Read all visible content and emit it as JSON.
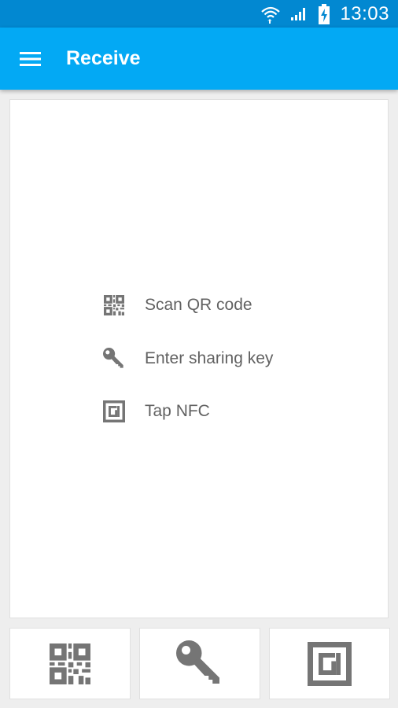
{
  "status_bar": {
    "time": "13:03",
    "icons": [
      "wifi-icon",
      "signal-icon",
      "battery-charging-icon"
    ]
  },
  "app_bar": {
    "title": "Receive",
    "menu_icon": "menu-icon"
  },
  "options": [
    {
      "label": "Scan QR code",
      "icon": "qr-code-icon"
    },
    {
      "label": "Enter sharing key",
      "icon": "key-icon"
    },
    {
      "label": "Tap NFC",
      "icon": "nfc-icon"
    }
  ],
  "bottom_buttons": [
    {
      "icon": "qr-code-icon"
    },
    {
      "icon": "key-icon"
    },
    {
      "icon": "nfc-icon"
    }
  ],
  "colors": {
    "status_bar": "#0288d1",
    "app_bar": "#03a9f4",
    "icon": "#757575",
    "text": "#616161",
    "background": "#eeeeee"
  }
}
